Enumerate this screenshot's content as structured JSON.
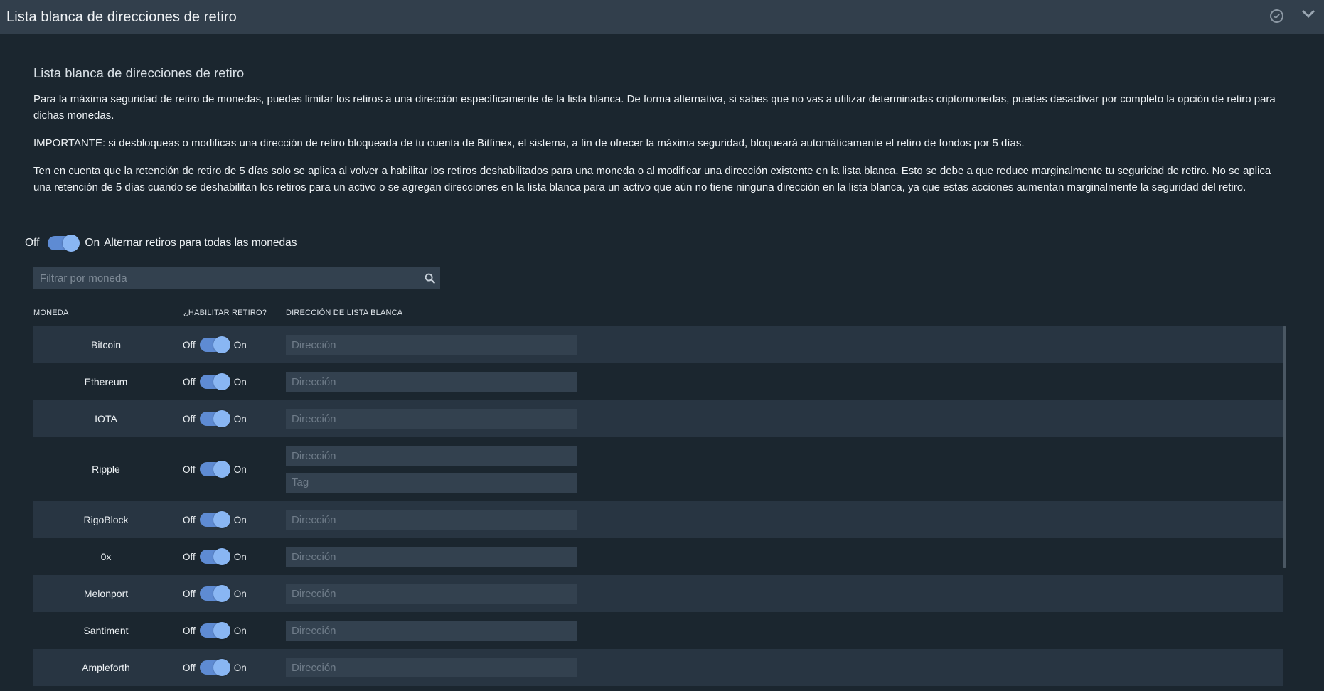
{
  "header": {
    "title": "Lista blanca de direcciones de retiro",
    "icons": [
      "check-circle-icon",
      "chevron-down-icon"
    ]
  },
  "section": {
    "heading": "Lista blanca de direcciones de retiro",
    "p1": "Para la máxima seguridad de retiro de monedas, puedes limitar los retiros a una dirección específicamente de la lista blanca. De forma alternativa, si sabes que no vas a utilizar determinadas criptomonedas, puedes desactivar por completo la opción de retiro para dichas monedas.",
    "p2": "IMPORTANTE: si desbloqueas o modificas una dirección de retiro bloqueada de tu cuenta de Bitfinex, el sistema, a fin de ofrecer la máxima seguridad, bloqueará automáticamente el retiro de fondos por 5 días.",
    "p3": "Ten en cuenta que la retención de retiro de 5 días solo se aplica al volver a habilitar los retiros deshabilitados para una moneda o al modificar una dirección existente en la lista blanca. Esto se debe a que reduce marginalmente tu seguridad de retiro. No se aplica una retención de 5 días cuando se deshabilitan los retiros para un activo o se agregan direcciones en la lista blanca para un activo que aún no tiene ninguna dirección en la lista blanca, ya que estas acciones aumentan marginalmente la seguridad del retiro."
  },
  "global_toggle": {
    "off_label": "Off",
    "on_label": "On",
    "label": "Alternar retiros para todas las monedas",
    "state": "on"
  },
  "filter": {
    "placeholder": "Filtrar por moneda",
    "value": ""
  },
  "table": {
    "headers": {
      "coin": "MONEDA",
      "enable": "¿HABILITAR RETIRO?",
      "address": "DIRECCIÓN DE LISTA BLANCA"
    },
    "off_label": "Off",
    "on_label": "On",
    "address_placeholder": "Dirección",
    "tag_placeholder": "Tag",
    "rows": [
      {
        "coin": "Bitcoin",
        "enabled": true
      },
      {
        "coin": "Ethereum",
        "enabled": true
      },
      {
        "coin": "IOTA",
        "enabled": true
      },
      {
        "coin": "Ripple",
        "enabled": true,
        "has_tag": true
      },
      {
        "coin": "RigoBlock",
        "enabled": true
      },
      {
        "coin": "0x",
        "enabled": true
      },
      {
        "coin": "Melonport",
        "enabled": true
      },
      {
        "coin": "Santiment",
        "enabled": true
      },
      {
        "coin": "Ampleforth",
        "enabled": true
      }
    ]
  },
  "colors": {
    "header_bg": "#323f4c",
    "panel_bg": "#1b262f",
    "row_alt_bg": "#283542",
    "input_bg": "#33414f",
    "toggle_track": "#5e8bd3",
    "toggle_knob": "#89b6f3"
  }
}
